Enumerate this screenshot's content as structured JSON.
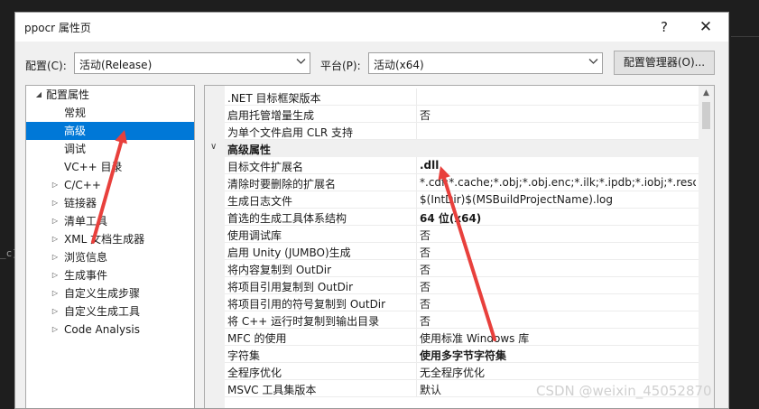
{
  "background": {
    "hint_text": "_c]"
  },
  "dialog": {
    "title": "ppocr 属性页",
    "help_label": "?",
    "close_label": "✕"
  },
  "toolbar": {
    "config_label": "配置(C):",
    "config_value": "活动(Release)",
    "platform_label": "平台(P):",
    "platform_value": "活动(x64)",
    "manager_button": "配置管理器(O)..."
  },
  "tree": {
    "items": [
      {
        "label": "配置属性",
        "arrow": "◢"
      },
      {
        "label": "常规"
      },
      {
        "label": "高级"
      },
      {
        "label": "调试"
      },
      {
        "label": "VC++ 目录"
      },
      {
        "label": "C/C++",
        "arrow": "▷"
      },
      {
        "label": "链接器",
        "arrow": "▷"
      },
      {
        "label": "清单工具",
        "arrow": "▷"
      },
      {
        "label": "XML 文档生成器",
        "arrow": "▷"
      },
      {
        "label": "浏览信息",
        "arrow": "▷"
      },
      {
        "label": "生成事件",
        "arrow": "▷"
      },
      {
        "label": "自定义生成步骤",
        "arrow": "▷"
      },
      {
        "label": "自定义生成工具",
        "arrow": "▷"
      },
      {
        "label": "Code Analysis",
        "arrow": "▷"
      }
    ],
    "selected_index": 2
  },
  "grid": {
    "top_rows": [
      {
        "name": ".NET 目标框架版本",
        "value": ""
      },
      {
        "name": "启用托管增量生成",
        "value": "否"
      },
      {
        "name": "为单个文件启用 CLR 支持",
        "value": ""
      }
    ],
    "category": {
      "label": "高级属性",
      "arrow": "∨"
    },
    "rows": [
      {
        "name": "目标文件扩展名",
        "value": ".dll",
        "bold": true
      },
      {
        "name": "清除时要删除的扩展名",
        "value": "*.cdf;*.cache;*.obj;*.obj.enc;*.ilk;*.ipdb;*.iobj;*.resources"
      },
      {
        "name": "生成日志文件",
        "value": "$(IntDir)$(MSBuildProjectName).log"
      },
      {
        "name": "首选的生成工具体系结构",
        "value": "64 位(x64)",
        "bold": true
      },
      {
        "name": "使用调试库",
        "value": "否"
      },
      {
        "name": "启用 Unity (JUMBO)生成",
        "value": "否"
      },
      {
        "name": "将内容复制到 OutDir",
        "value": "否"
      },
      {
        "name": "将项目引用复制到 OutDir",
        "value": "否"
      },
      {
        "name": "将项目引用的符号复制到 OutDir",
        "value": "否"
      },
      {
        "name": "将 C++ 运行时复制到输出目录",
        "value": "否"
      },
      {
        "name": "MFC 的使用",
        "value": "使用标准 Windows 库"
      },
      {
        "name": "字符集",
        "value": "使用多字节字符集",
        "bold": true
      },
      {
        "name": "全程序优化",
        "value": "无全程序优化"
      },
      {
        "name": "MSVC 工具集版本",
        "value": "默认"
      }
    ]
  },
  "annotation_color": "#e8403c",
  "watermark": "CSDN @weixin_45052870"
}
